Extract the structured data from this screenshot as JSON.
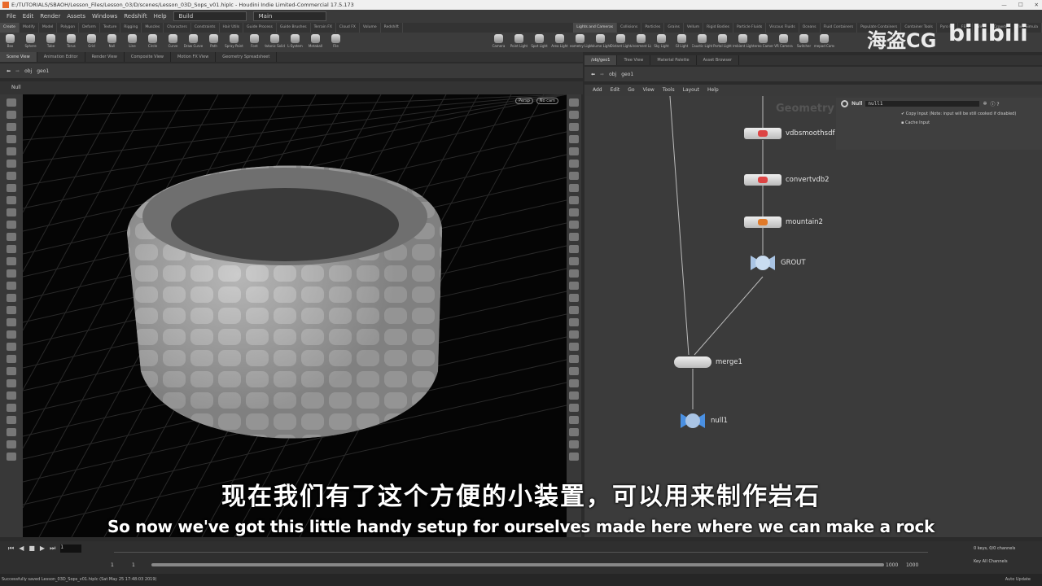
{
  "window": {
    "title": "E:/TUTORIALS/SBAOH/Lesson_Files/Lesson_03/D/scenes/Lesson_03D_Sops_v01.hiplc - Houdini Indie Limited-Commercial 17.5.173"
  },
  "menu": [
    "File",
    "Edit",
    "Render",
    "Assets",
    "Windows",
    "Redshift",
    "Help"
  ],
  "desktop": "Build",
  "context": "Main",
  "shelf_tabs_left": [
    "Create",
    "Modify",
    "Model",
    "Polygon",
    "Deform",
    "Texture",
    "Rigging",
    "Muscles",
    "Characters",
    "Constraints",
    "Hair Utils",
    "Guide Process",
    "Guide Brushes",
    "Terrain FX",
    "Cloud FX",
    "Volume",
    "Redshift"
  ],
  "shelf_tools_left": [
    "Box",
    "Sphere",
    "Tube",
    "Torus",
    "Grid",
    "Null",
    "Line",
    "Circle",
    "Curve",
    "Draw Curve",
    "Path",
    "Spray Paint",
    "Font",
    "Platonic Solids",
    "L-System",
    "Metaball",
    "File"
  ],
  "shelf_tabs_right": [
    "Lights and Cameras",
    "Collisions",
    "Particles",
    "Grains",
    "Vellum",
    "Rigid Bodies",
    "Particle Fluids",
    "Viscous Fluids",
    "Oceans",
    "Fluid Containers",
    "Populate Containers",
    "Container Tools",
    "Pyro FX",
    "FEM",
    "Wires",
    "Crowds",
    "Drive Simula"
  ],
  "shelf_tools_right": [
    "Camera",
    "Point Light",
    "Spot Light",
    "Area Light",
    "Geometry Light",
    "Volume Light",
    "Distant Light",
    "Environment Light",
    "Sky Light",
    "GI Light",
    "Caustic Light",
    "Portal Light",
    "Ambient Light",
    "Stereo Camera",
    "VR Camera",
    "Switcher",
    "Gamepad Camera"
  ],
  "left_pane": {
    "tabs": [
      "Scene View",
      "Animation Editor",
      "Render View",
      "Composite View",
      "Motion FX View",
      "Geometry Spreadsheet"
    ],
    "path": [
      "obj",
      "geo1"
    ],
    "toolbar_label": "Null",
    "persp": "Persp",
    "cam": "No cam"
  },
  "right_pane": {
    "tabs": [
      "/obj/geo1",
      "Tree View",
      "Material Palette",
      "Asset Browser"
    ],
    "path": [
      "obj",
      "geo1"
    ],
    "menu": [
      "Add",
      "Edit",
      "Go",
      "View",
      "Tools",
      "Layout",
      "Help"
    ],
    "watermark": "Geometry",
    "nodes": [
      {
        "name": "vdbsmoothsdf"
      },
      {
        "name": "convertvdb2"
      },
      {
        "name": "mountain2"
      },
      {
        "name": "GROUT",
        "type": "null"
      },
      {
        "name": "merge1"
      },
      {
        "name": "null1"
      }
    ]
  },
  "params": {
    "type": "Null",
    "name": "null1",
    "copy_input": "Copy Input (Note: input will be still cooked if disabled)",
    "copy_input_checked": true,
    "cache_input": "Cache Input",
    "cache_input_checked": false
  },
  "subtitles": {
    "cn": "现在我们有了这个方便的小装置，可以用来制作岩石",
    "en": "So now we've got this little handy setup for ourselves made here where we can make a rock"
  },
  "watermark": {
    "left": "海盗CG",
    "right": "bilibili"
  },
  "timeline": {
    "frame": "1",
    "start": "1",
    "start2": "1",
    "end": "1000",
    "end2": "1000",
    "keys": "0 keys, 0/0 channels",
    "key_all": "Key All Channels"
  },
  "status": {
    "message": "Successfully saved Lesson_03D_Sops_v01.hiplc (Sat May 25 17:48:03 2019)",
    "auto_update": "Auto Update"
  }
}
